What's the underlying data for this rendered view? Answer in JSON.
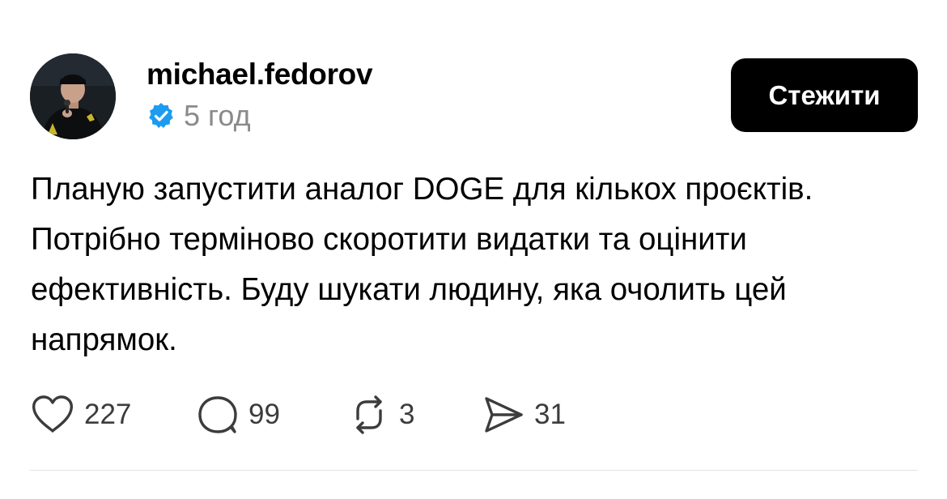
{
  "post": {
    "username": "michael.fedorov",
    "verified": true,
    "time": "5 год",
    "follow_label": "Стежити",
    "text": "Планую запустити аналог DOGE для кількох проєктів. Потрібно терміново скоротити видатки та оцінити ефективність. Буду шукати людину, яка очолить цей напрямок.",
    "actions": {
      "likes": "227",
      "comments": "99",
      "reposts": "3",
      "shares": "31"
    }
  },
  "icons": {
    "verified": "verified-badge-icon",
    "like": "heart-icon",
    "comment": "comment-bubble-icon",
    "repost": "repost-icon",
    "share": "send-icon"
  },
  "colors": {
    "verified_badge": "#1d9bf0",
    "button_bg": "#000000",
    "button_text": "#ffffff",
    "muted_text": "#8a8a8a",
    "divider": "#e4e4e4"
  }
}
